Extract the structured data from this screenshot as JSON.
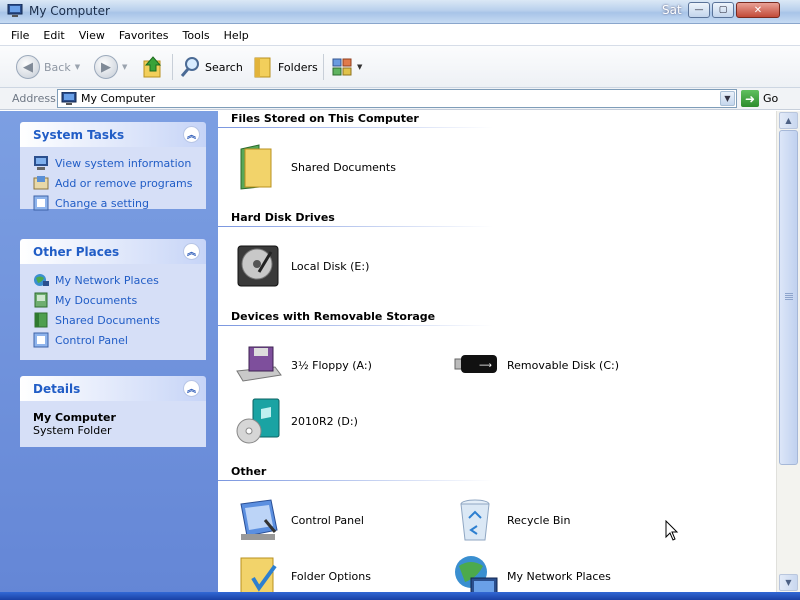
{
  "window": {
    "title": "My Computer",
    "clock": "Sat",
    "buttons": {
      "minimize": "—",
      "maximize": "▢",
      "close": "✕"
    }
  },
  "menu": [
    "File",
    "Edit",
    "View",
    "Favorites",
    "Tools",
    "Help"
  ],
  "toolbar": {
    "back_label": "Back",
    "search_label": "Search",
    "folders_label": "Folders"
  },
  "address": {
    "label": "Address",
    "value": "My Computer",
    "go_label": "Go"
  },
  "taskpane": {
    "system_tasks": {
      "title": "System Tasks",
      "items": [
        "View system information",
        "Add or remove programs",
        "Change a setting"
      ]
    },
    "other_places": {
      "title": "Other Places",
      "items": [
        "My Network Places",
        "My Documents",
        "Shared Documents",
        "Control Panel"
      ]
    },
    "details": {
      "title": "Details",
      "name": "My Computer",
      "type": "System Folder"
    }
  },
  "content": {
    "groups": [
      {
        "title": "Files Stored on This Computer",
        "items": [
          "Shared Documents"
        ]
      },
      {
        "title": "Hard Disk Drives",
        "items": [
          "Local Disk (E:)"
        ]
      },
      {
        "title": "Devices with Removable Storage",
        "items": [
          "3½ Floppy (A:)",
          "Removable Disk (C:)",
          "2010R2 (D:)"
        ]
      },
      {
        "title": "Other",
        "items": [
          "Control Panel",
          "Recycle Bin",
          "Folder Options",
          "My Network Places"
        ]
      }
    ]
  },
  "colors": {
    "taskpane_bg": "#7c9fe2",
    "task_link": "#215dc6",
    "panel_body": "#d6dff7"
  }
}
